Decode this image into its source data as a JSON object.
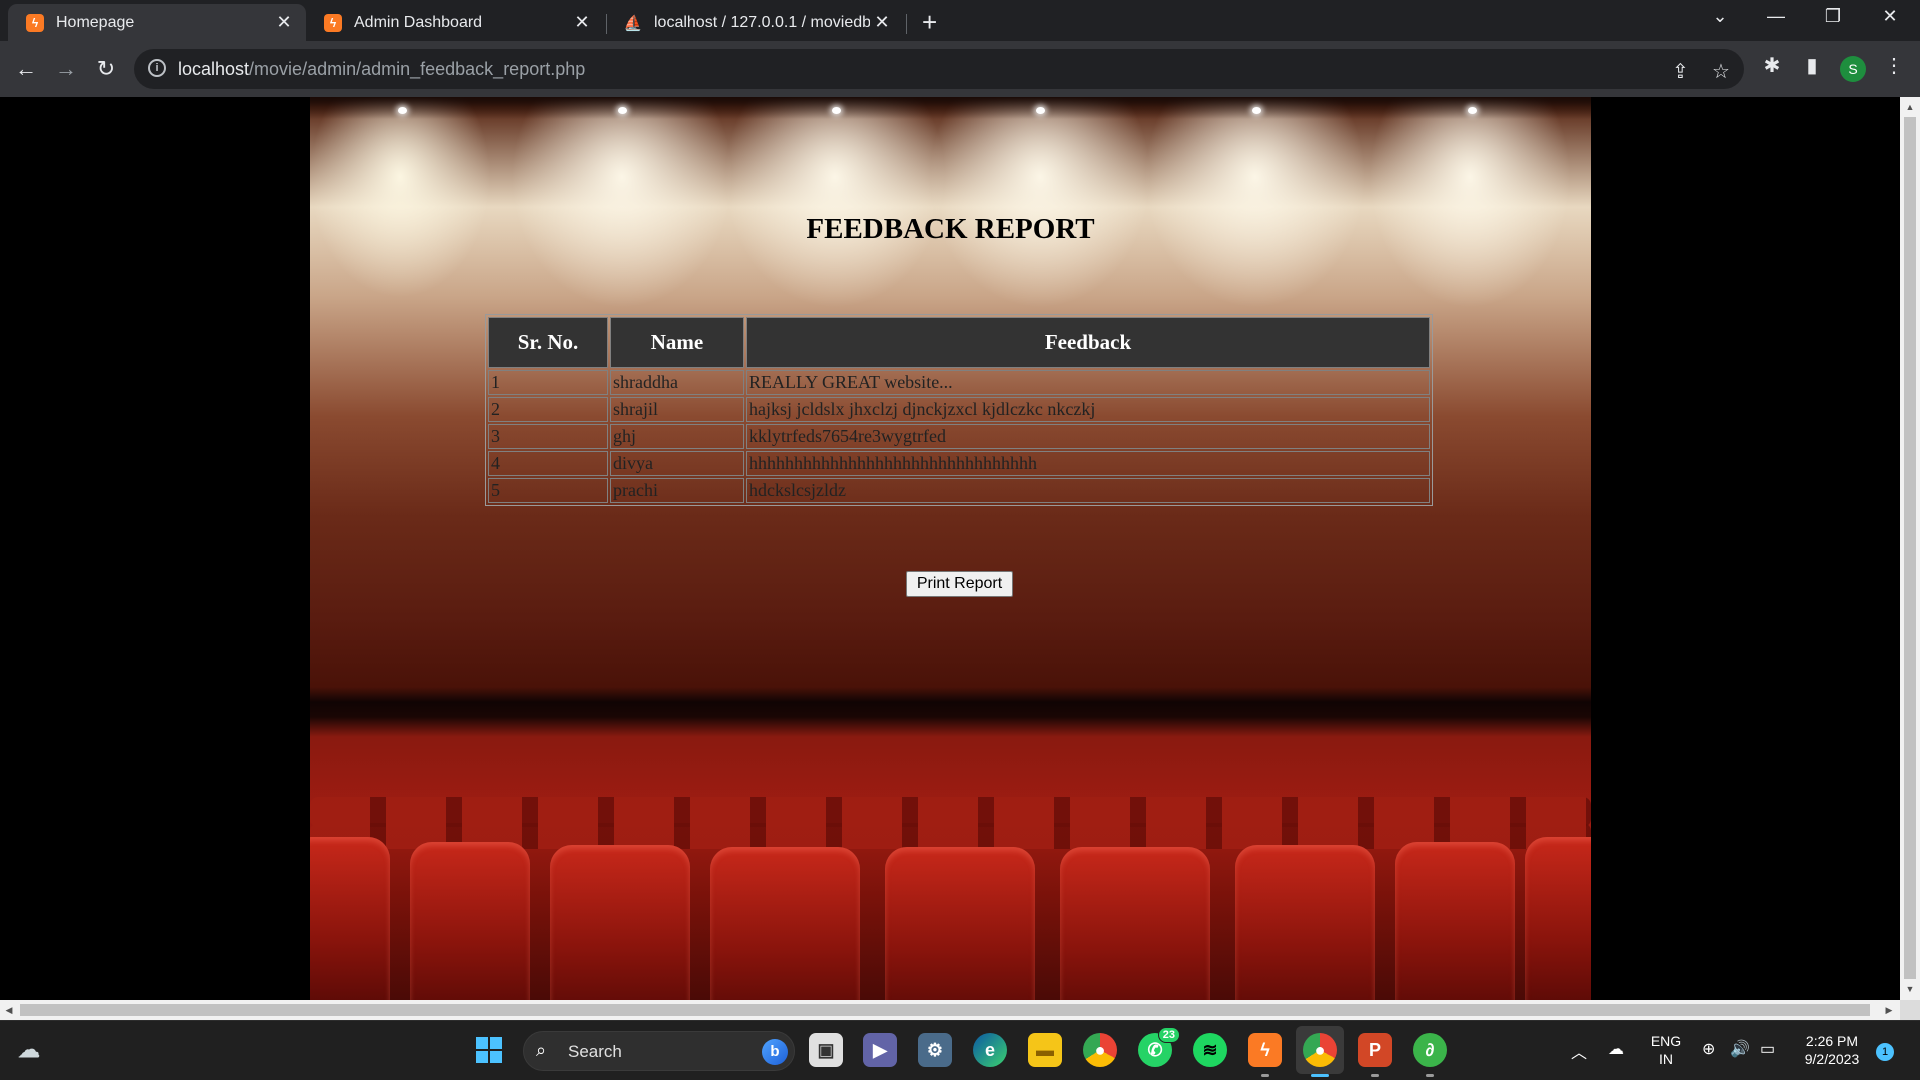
{
  "browser": {
    "tabs": [
      {
        "title": "Homepage",
        "favicon": "xampp-icon"
      },
      {
        "title": "Admin Dashboard",
        "favicon": "xampp-icon"
      },
      {
        "title": "localhost / 127.0.0.1 / moviedb /",
        "favicon": "phpmyadmin-icon"
      }
    ],
    "url_host": "localhost",
    "url_path": "/movie/admin/admin_feedback_report.php",
    "profile_initial": "S"
  },
  "page": {
    "title": "FEEDBACK REPORT",
    "table": {
      "headers": [
        "Sr. No.",
        "Name",
        "Feedback"
      ],
      "rows": [
        [
          "1",
          "shraddha",
          "REALLY GREAT website..."
        ],
        [
          "2",
          "shrajil",
          "hajksj jcldslx jhxclzj djnckjzxcl kjdlczkc nkczkj"
        ],
        [
          "3",
          "ghj",
          "kklytrfeds7654re3wygtrfed"
        ],
        [
          "4",
          "divya",
          "hhhhhhhhhhhhhhhhhhhhhhhhhhhhhhhh"
        ],
        [
          "5",
          "prachi",
          "hdckslcsjzldz"
        ]
      ]
    },
    "print_button": "Print Report"
  },
  "taskbar": {
    "search_label": "Search",
    "whatsapp_badge": "23",
    "lang_line1": "ENG",
    "lang_line2": "IN",
    "time": "2:26 PM",
    "date": "9/2/2023",
    "notification_count": "1"
  },
  "colors": {
    "chrome_dark": "#202124",
    "chrome_toolbar": "#35363a",
    "table_header_bg": "#333333",
    "taskbar_bg": "#202020"
  }
}
